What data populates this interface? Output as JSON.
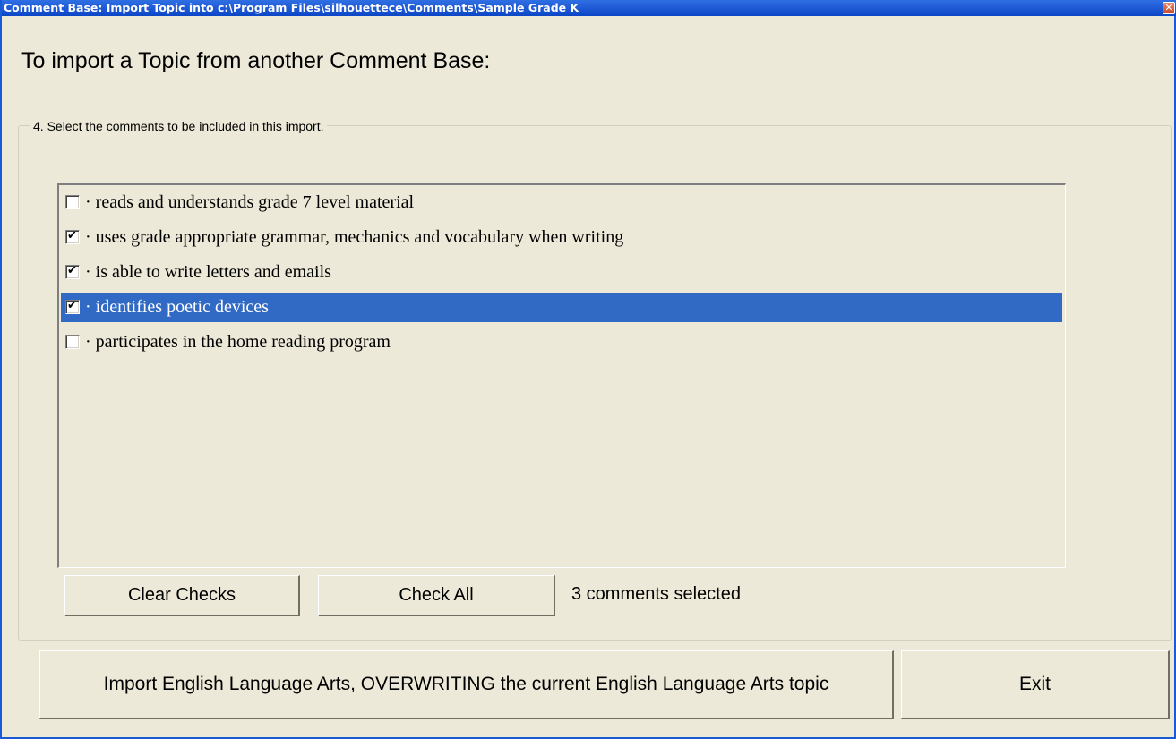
{
  "window": {
    "title": "Comment Base: Import Topic into c:\\Program Files\\silhouettece\\Comments\\Sample Grade K",
    "close_icon": "close-icon",
    "close_glyph": "✕"
  },
  "heading": "To import a Topic from another Comment Base:",
  "group": {
    "legend": "4. Select the comments to be included in this import."
  },
  "comments": [
    {
      "label": "· reads and understands grade 7 level material",
      "checked": false,
      "selected": false
    },
    {
      "label": "· uses grade appropriate grammar, mechanics and vocabulary when writing",
      "checked": true,
      "selected": false
    },
    {
      "label": "· is able to write letters and emails",
      "checked": true,
      "selected": false
    },
    {
      "label": "· identifies poetic devices",
      "checked": true,
      "selected": true
    },
    {
      "label": "· participates in the home reading program",
      "checked": false,
      "selected": false
    }
  ],
  "buttons": {
    "clear_checks": "Clear Checks",
    "check_all": "Check All",
    "import": "Import English Language Arts, OVERWRITING the current English Language Arts topic",
    "exit": "Exit"
  },
  "status": "3 comments selected",
  "colors": {
    "titlebar": "#1f5ad6",
    "selection": "#316ac5",
    "background": "#ece9d8"
  }
}
